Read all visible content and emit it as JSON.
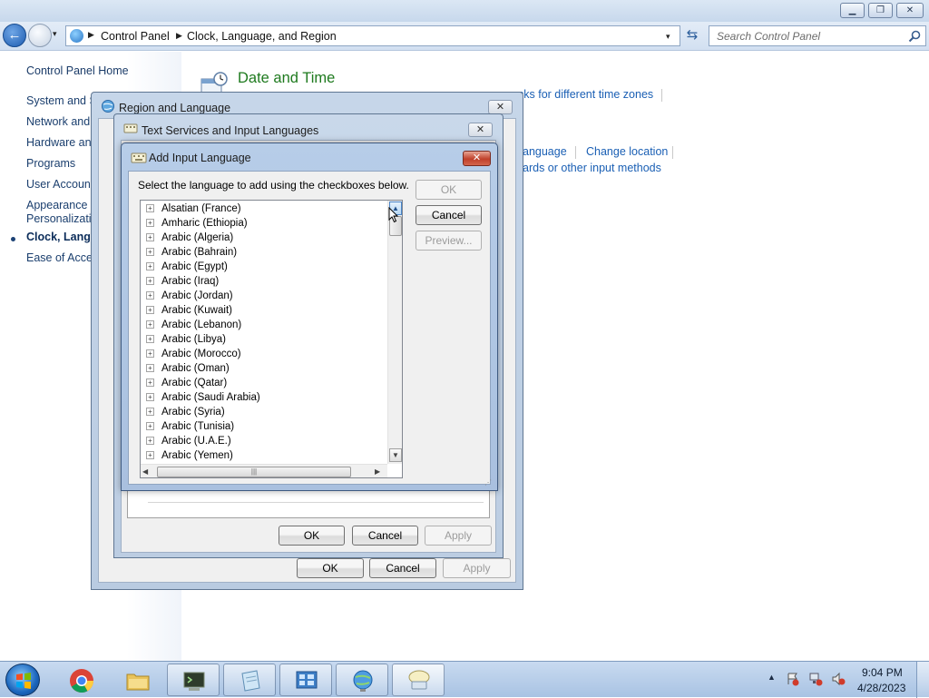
{
  "window": {
    "minimize": "▁",
    "maximize": "❐",
    "close": "✕"
  },
  "nav": {
    "back": "←",
    "forward": "→",
    "history_arrow": "▾",
    "breadcrumb_sep": "▶",
    "breadcrumbs": [
      "Control Panel",
      "Clock, Language, and Region"
    ],
    "address_dropdown": "▾",
    "refresh": "⇆",
    "search_placeholder": "Search Control Panel"
  },
  "sidebar": {
    "home": "Control Panel Home",
    "items": [
      {
        "label": "System and S"
      },
      {
        "label": "Network and"
      },
      {
        "label": "Hardware and"
      },
      {
        "label": "Programs"
      },
      {
        "label": "User Account"
      },
      {
        "label": "Appearance a"
      },
      {
        "label": "Personalizati"
      },
      {
        "label": "Clock, Langua"
      },
      {
        "label": "Ease of Acces"
      }
    ]
  },
  "main": {
    "section_title": "Date and Time",
    "links": {
      "clocks": "cks for different time zones",
      "change_language": "anguage",
      "change_location": "Change location",
      "keyboards": "ards or other input methods"
    }
  },
  "region_dialog": {
    "title": "Region and Language",
    "close": "✕",
    "ok": "OK",
    "cancel": "Cancel",
    "apply": "Apply"
  },
  "text_services_dialog": {
    "title": "Text Services and Input Languages",
    "close": "✕",
    "ok": "OK",
    "cancel": "Cancel",
    "apply": "Apply"
  },
  "add_input_dialog": {
    "title": "Add Input Language",
    "close": "✕",
    "instruction": "Select the language to add using the checkboxes below.",
    "ok": "OK",
    "cancel": "Cancel",
    "preview": "Preview...",
    "expander": "+",
    "languages": [
      "Alsatian (France)",
      "Amharic (Ethiopia)",
      "Arabic (Algeria)",
      "Arabic (Bahrain)",
      "Arabic (Egypt)",
      "Arabic (Iraq)",
      "Arabic (Jordan)",
      "Arabic (Kuwait)",
      "Arabic (Lebanon)",
      "Arabic (Libya)",
      "Arabic (Morocco)",
      "Arabic (Oman)",
      "Arabic (Qatar)",
      "Arabic (Saudi Arabia)",
      "Arabic (Syria)",
      "Arabic (Tunisia)",
      "Arabic (U.A.E.)",
      "Arabic (Yemen)"
    ],
    "scroll_up": "▲",
    "scroll_down": "▼",
    "scroll_left": "◀",
    "scroll_right": "▶",
    "hscroll_grip": "|||",
    "resize_grip": "⋰"
  },
  "taskbar": {
    "items": [
      {
        "icon": "chrome-icon"
      },
      {
        "icon": "folder-icon"
      },
      {
        "icon": "terminal-icon"
      },
      {
        "icon": "notepad-icon"
      },
      {
        "icon": "control-panel-icon"
      },
      {
        "icon": "region-globe-icon"
      },
      {
        "icon": "text-services-icon"
      }
    ],
    "tray_arrow": "▲",
    "time": "9:04 PM",
    "date": "4/28/2023"
  },
  "colors": {
    "link": "#1a5fb4",
    "heading_green": "#1e7a1e",
    "close_red": "#c0402a"
  }
}
